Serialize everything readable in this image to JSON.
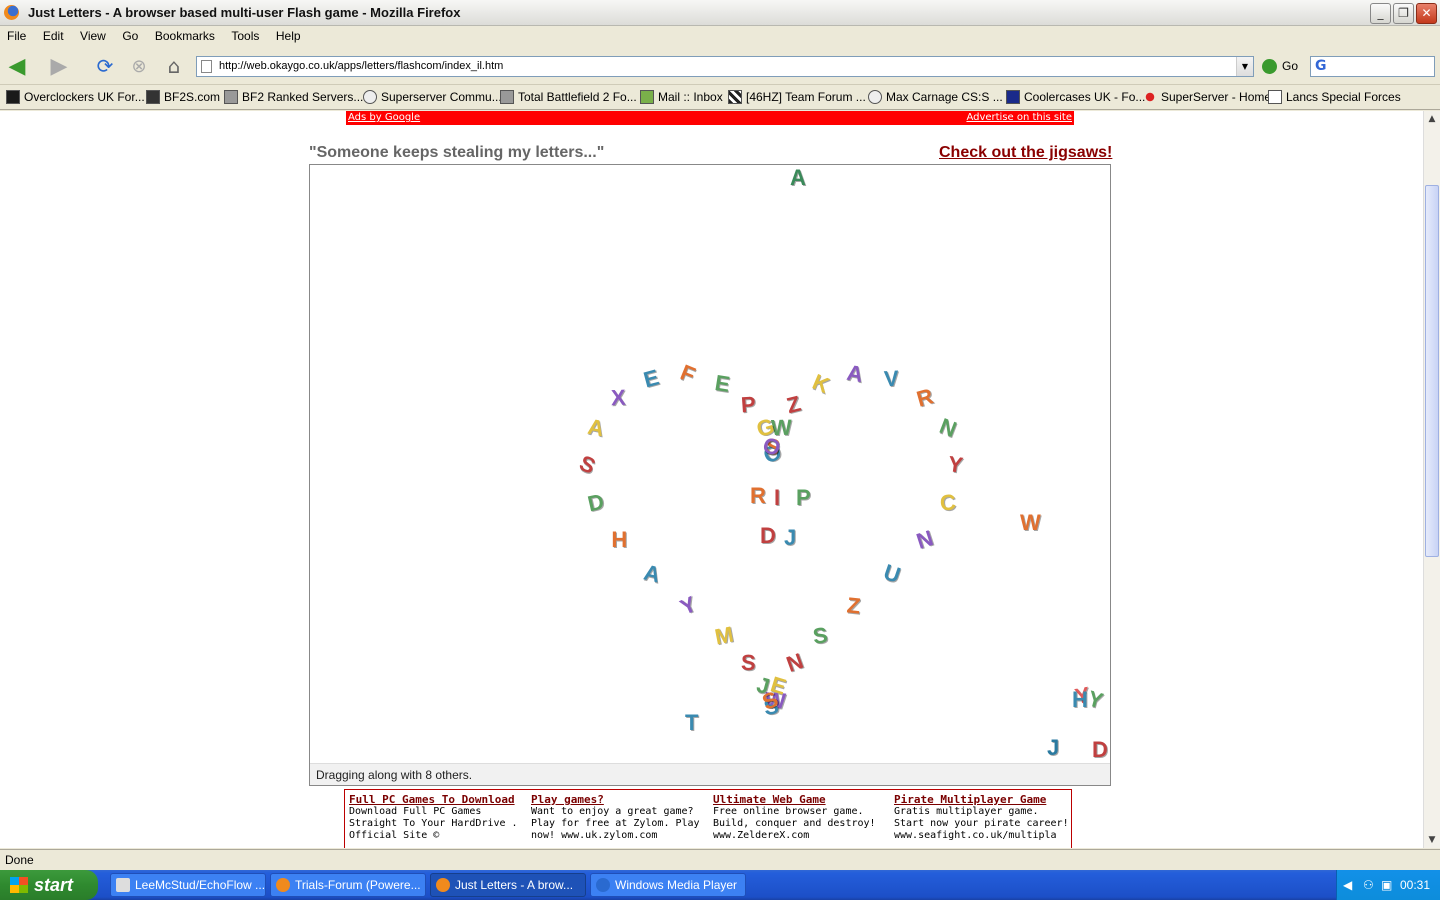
{
  "window": {
    "title": "Just Letters - A browser based multi-user Flash game - Mozilla Firefox"
  },
  "menu": [
    "File",
    "Edit",
    "View",
    "Go",
    "Bookmarks",
    "Tools",
    "Help"
  ],
  "nav": {
    "url": "http://web.okaygo.co.uk/apps/letters/flashcom/index_il.htm",
    "go_label": "Go"
  },
  "bookmarks": [
    "Overclockers UK For...",
    "BF2S.com",
    "BF2 Ranked Servers...",
    "Superserver Commu...",
    "Total Battlefield 2 Fo...",
    "Mail :: Inbox",
    "[46HZ] Team Forum ...",
    "Max Carnage CS:S ...",
    "Coolercases UK - Fo...",
    "SuperServer - Home",
    "Lancs Special Forces"
  ],
  "page": {
    "ads_by_google": "Ads by Google",
    "advertise": "Advertise on this site",
    "tagline": "\"Someone keeps stealing my letters...\"",
    "jigsaw_link": "Check out the jigsaws!",
    "game_status": "Dragging along with 8 others."
  },
  "game_letters": {
    "scattered": [
      {
        "ch": "A",
        "color": "#3a8a5a"
      },
      {
        "ch": "W",
        "color": "#e07030"
      },
      {
        "ch": "T",
        "color": "#3a8ab0"
      },
      {
        "ch": "J",
        "color": "#2a7aa0"
      },
      {
        "ch": "D",
        "color": "#c04040"
      },
      {
        "ch": "Y",
        "color": "#e05a5a"
      },
      {
        "ch": "Y",
        "color": "#5aa060"
      },
      {
        "ch": "H",
        "color": "#3a8ab0"
      }
    ],
    "center": [
      {
        "ch": "R",
        "color": "#e07030"
      },
      {
        "ch": "I",
        "color": "#c04040"
      },
      {
        "ch": "P",
        "color": "#5aa060"
      },
      {
        "ch": "D",
        "color": "#c04040"
      },
      {
        "ch": "J",
        "color": "#3a8ab0"
      }
    ],
    "heart": "OSWZKAVRNYCNUZSNEWSSJSMYAHDSAXEFEPGO",
    "heart_colors": [
      "#3a8ab0",
      "#e07030",
      "#5aa060",
      "#c04040",
      "#e0c040",
      "#8a5ac0"
    ]
  },
  "ads": [
    {
      "title": "Full PC Games To Download",
      "body": "Download Full PC Games Straight To Your HardDrive . Official Site ©"
    },
    {
      "title": "Play games?",
      "body": "Want to enjoy a great game? Play for free at Zylom. Play now! www.uk.zylom.com"
    },
    {
      "title": "Ultimate Web Game",
      "body": "Free online browser game. Build, conquer and destroy! www.ZeldereX.com"
    },
    {
      "title": "Pirate Multiplayer Game",
      "body": "Gratis multiplayer game. Start now your pirate career! www.seafight.co.uk/multipla"
    }
  ],
  "status": "Done",
  "taskbar": {
    "start": "start",
    "tasks": [
      "LeeMcStud/EchoFlow ...",
      "Trials-Forum (Powere...",
      "Just Letters - A brow...",
      "Windows Media Player"
    ],
    "clock": "00:31"
  }
}
